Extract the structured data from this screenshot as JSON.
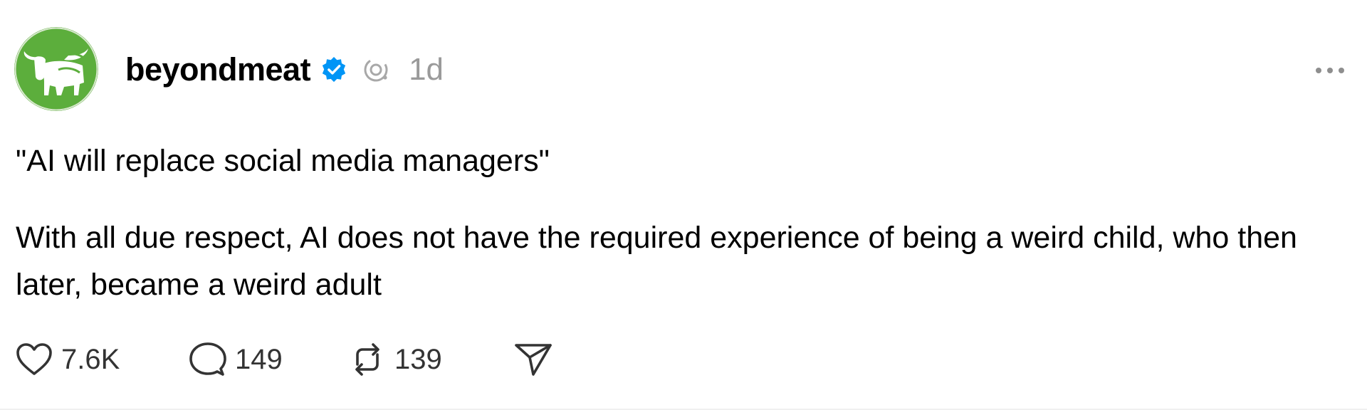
{
  "post": {
    "author": {
      "username": "beyondmeat",
      "verified": true,
      "avatar_icon": "beyond-meat-bull-logo",
      "avatar_color": "#5cae3c"
    },
    "timestamp": "1d",
    "text_lines": [
      "\"AI will replace social media managers\"",
      "With all due respect, AI does not have the required experience of being a weird child, who then later, became a weird adult"
    ],
    "actions": {
      "like": {
        "icon": "heart-icon",
        "count": "7.6K"
      },
      "reply": {
        "icon": "speech-bubble-icon",
        "count": "149"
      },
      "repost": {
        "icon": "repost-icon",
        "count": "139"
      },
      "share": {
        "icon": "send-icon"
      }
    },
    "colors": {
      "verified_badge": "#0095f6",
      "muted_text": "#9a9a9a"
    }
  }
}
